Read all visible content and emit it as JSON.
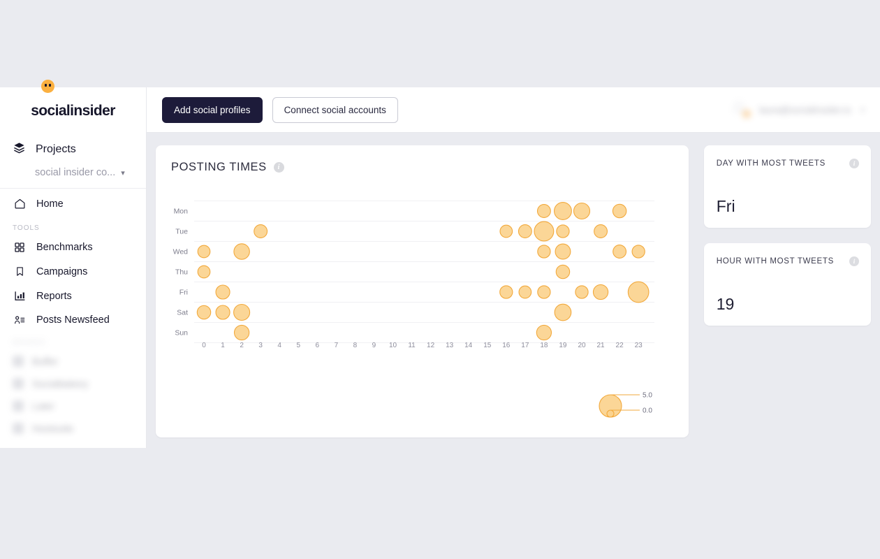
{
  "brand": {
    "name": "socialinsider",
    "logo_icon": "socialinsider-logo"
  },
  "sidebar": {
    "projects_label": "Projects",
    "projects_icon": "layers-icon",
    "project_selected": "social insider co...",
    "project_chevron_icon": "chevron-down-icon",
    "home": {
      "label": "Home",
      "icon": "home-icon"
    },
    "tools_heading": "TOOLS",
    "tools": [
      {
        "label": "Benchmarks",
        "icon": "grid-icon"
      },
      {
        "label": "Campaigns",
        "icon": "bookmark-icon"
      },
      {
        "label": "Reports",
        "icon": "bar-chart-icon"
      },
      {
        "label": "Posts Newsfeed",
        "icon": "person-list-icon"
      }
    ],
    "brands_heading": "BRANDS",
    "brands": [
      {
        "label": "Buffer"
      },
      {
        "label": "Socialbakery"
      },
      {
        "label": "Later"
      },
      {
        "label": "Hootsuite"
      }
    ]
  },
  "topbar": {
    "add_profiles_label": "Add social profiles",
    "connect_accounts_label": "Connect social accounts",
    "bell_icon": "notification-bell-icon",
    "bell_badge": "3",
    "user_email": "laura@socialinsider.io",
    "user_chevron_icon": "chevron-down-icon"
  },
  "main": {
    "chart_title": "POSTING TIMES",
    "chart_info_icon": "info-icon"
  },
  "stats": [
    {
      "title": "DAY WITH MOST TWEETS",
      "value": "Fri",
      "info_icon": "info-icon"
    },
    {
      "title": "HOUR WITH MOST TWEETS",
      "value": "19",
      "info_icon": "info-icon"
    }
  ],
  "chart_data": {
    "type": "scatter",
    "title": "POSTING TIMES",
    "xlabel": "",
    "ylabel": "",
    "xlim": [
      0,
      23
    ],
    "grid": true,
    "bubble_color": "#fbd38e",
    "bubble_stroke": "#f2a93c",
    "x_ticks": [
      "0",
      "1",
      "2",
      "3",
      "4",
      "5",
      "6",
      "7",
      "8",
      "9",
      "10",
      "11",
      "12",
      "13",
      "14",
      "15",
      "16",
      "17",
      "18",
      "19",
      "20",
      "21",
      "22",
      "23"
    ],
    "y_categories": [
      "Mon",
      "Tue",
      "Wed",
      "Thu",
      "Fri",
      "Sat",
      "Sun"
    ],
    "legend": {
      "position": "bottom-right",
      "max_label": "5.0",
      "min_label": "0.0",
      "max_value": 5.0,
      "min_value": 0.0
    },
    "points": [
      {
        "day": "Mon",
        "hour": 18,
        "value": 1.6
      },
      {
        "day": "Mon",
        "hour": 19,
        "value": 2.6
      },
      {
        "day": "Mon",
        "hour": 20,
        "value": 2.3
      },
      {
        "day": "Mon",
        "hour": 22,
        "value": 1.7
      },
      {
        "day": "Tue",
        "hour": 3,
        "value": 1.6
      },
      {
        "day": "Tue",
        "hour": 16,
        "value": 1.4
      },
      {
        "day": "Tue",
        "hour": 17,
        "value": 1.6
      },
      {
        "day": "Tue",
        "hour": 18,
        "value": 3.1
      },
      {
        "day": "Tue",
        "hour": 19,
        "value": 1.5
      },
      {
        "day": "Tue",
        "hour": 21,
        "value": 1.6
      },
      {
        "day": "Wed",
        "hour": 0,
        "value": 1.4
      },
      {
        "day": "Wed",
        "hour": 2,
        "value": 2.2
      },
      {
        "day": "Wed",
        "hour": 18,
        "value": 1.5
      },
      {
        "day": "Wed",
        "hour": 19,
        "value": 2.1
      },
      {
        "day": "Wed",
        "hour": 22,
        "value": 1.6
      },
      {
        "day": "Wed",
        "hour": 23,
        "value": 1.5
      },
      {
        "day": "Thu",
        "hour": 0,
        "value": 1.4
      },
      {
        "day": "Thu",
        "hour": 19,
        "value": 1.7
      },
      {
        "day": "Fri",
        "hour": 1,
        "value": 1.8
      },
      {
        "day": "Fri",
        "hour": 16,
        "value": 1.5
      },
      {
        "day": "Fri",
        "hour": 17,
        "value": 1.4
      },
      {
        "day": "Fri",
        "hour": 18,
        "value": 1.5
      },
      {
        "day": "Fri",
        "hour": 20,
        "value": 1.5
      },
      {
        "day": "Fri",
        "hour": 21,
        "value": 2.0
      },
      {
        "day": "Fri",
        "hour": 23,
        "value": 3.4
      },
      {
        "day": "Sat",
        "hour": 0,
        "value": 1.7
      },
      {
        "day": "Sat",
        "hour": 1,
        "value": 1.8
      },
      {
        "day": "Sat",
        "hour": 2,
        "value": 2.3
      },
      {
        "day": "Sat",
        "hour": 19,
        "value": 2.4
      },
      {
        "day": "Sun",
        "hour": 2,
        "value": 2.0
      },
      {
        "day": "Sun",
        "hour": 18,
        "value": 2.0
      }
    ]
  }
}
